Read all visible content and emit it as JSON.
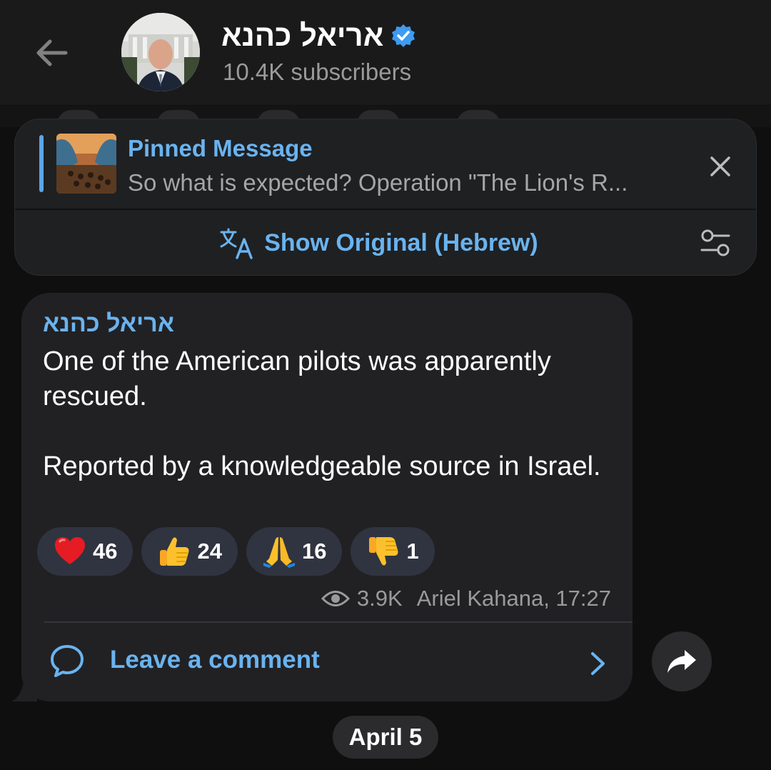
{
  "header": {
    "channel_name": "אריאל כהנא",
    "subscribers": "10.4K subscribers"
  },
  "pinned": {
    "title": "Pinned Message",
    "preview": "So what is expected? Operation \"The Lion's R...",
    "translate_label": "Show Original (Hebrew)"
  },
  "message": {
    "sender": "אריאל כהנא",
    "paragraph1": "One of the American pilots was apparently rescued.",
    "paragraph2": "Reported by a knowledgeable source in Israel.",
    "reactions": [
      {
        "emoji": "heart",
        "count": "46"
      },
      {
        "emoji": "thumbs-up",
        "count": "24"
      },
      {
        "emoji": "folded-hands",
        "count": "16"
      },
      {
        "emoji": "thumbs-down",
        "count": "1"
      }
    ],
    "views": "3.9K",
    "author_time": "Ariel Kahana, 17:27",
    "comment_label": "Leave a comment"
  },
  "date_chip": "April 5",
  "colors": {
    "accent": "#6ab3ef",
    "background": "#0f0f10",
    "bubble": "#212124",
    "reaction_chip": "#2f3440",
    "verified": "#3d9bf0"
  }
}
